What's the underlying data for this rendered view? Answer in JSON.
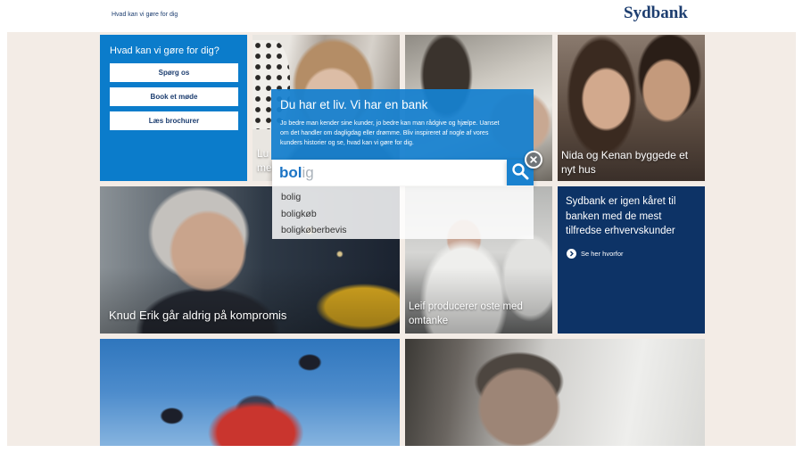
{
  "header": {
    "help_link": "Hvad kan vi gøre for dig",
    "logo": "Sydbank"
  },
  "help_tile": {
    "title": "Hvad kan vi gøre for dig?",
    "buttons": [
      "Spørg os",
      "Book et møde",
      "Læs brochurer"
    ]
  },
  "stories": {
    "lucas": {
      "caption_lines": [
        "Lu",
        "me"
      ]
    },
    "nida": {
      "caption_lines": [
        "Nida og Kenan byggede et",
        "nyt hus"
      ]
    },
    "knud": {
      "caption_lines": [
        "Knud Erik går aldrig på kompromis"
      ]
    },
    "leif": {
      "caption_lines": [
        "Leif producerer oste med",
        "omtanke"
      ]
    }
  },
  "award_tile": {
    "lines": [
      "Sydbank er igen kåret til",
      "banken med de mest",
      "tilfredse erhvervskunder"
    ],
    "link": "Se her hvorfor",
    "link_icon": "arrow-right-circle-icon"
  },
  "search_overlay": {
    "title": "Du har et liv. Vi har en bank",
    "intro_lines": [
      "Jo bedre man kender sine kunder, jo bedre kan man rådgive og hjælpe. Uanset",
      "om det handler om dagligdag eller drømme. Bliv inspireret af nogle af vores",
      "kunders historier og se, hvad kan vi gøre for dig."
    ],
    "query_typed": "bol",
    "query_completion": "ig",
    "search_icon": "search-icon",
    "close_icon": "close-icon",
    "suggestions": [
      "bolig",
      "boligkøb",
      "boligkøberbevis"
    ]
  },
  "colors": {
    "brand_navy": "#1d3e70",
    "help_blue": "#0b7ccb",
    "award_navy": "#0d3366",
    "overlay_blue": "#1681cf",
    "search_blue": "#1a82cf",
    "typed_blue": "#1b74c5",
    "hint_grey": "#aab2ba",
    "page_beige": "#f3ece6"
  }
}
